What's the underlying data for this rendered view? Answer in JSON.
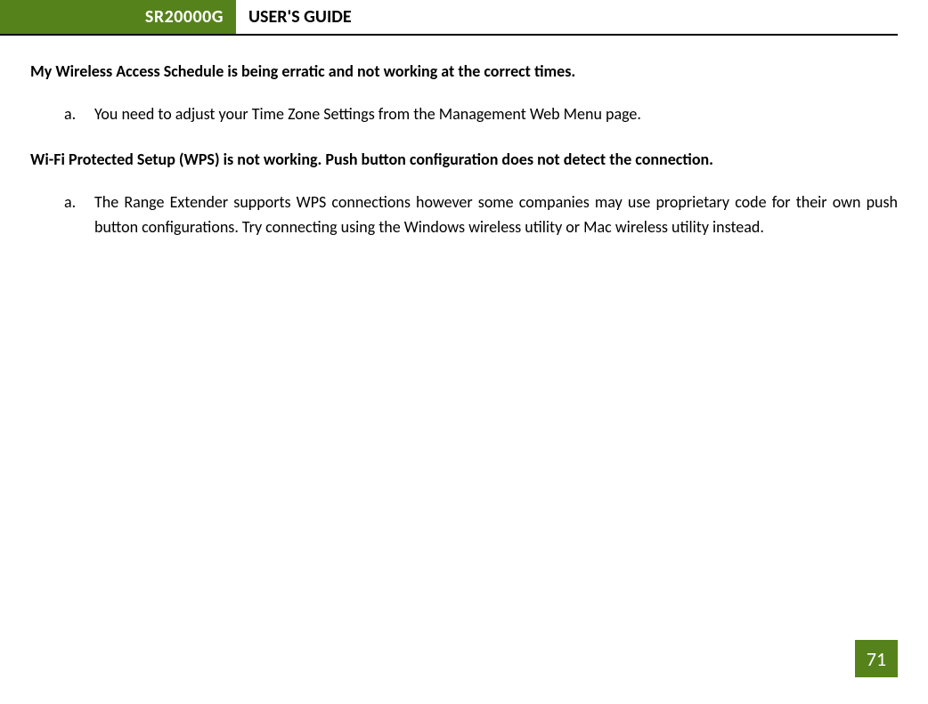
{
  "header": {
    "model": "SR20000G",
    "title": "USER'S GUIDE"
  },
  "sections": [
    {
      "heading": "My Wireless Access Schedule is being erratic and not working at the correct times.",
      "items": [
        {
          "marker": "a.",
          "text": "You need to adjust your Time Zone Settings from the Management Web Menu page."
        }
      ]
    },
    {
      "heading": "Wi-Fi Protected Setup (WPS) is not working. Push button configuration does not detect the connection.",
      "items": [
        {
          "marker": "a.",
          "text": "The Range Extender supports WPS connections however some companies may use proprietary code for their own push button configurations. Try connecting using the Windows wireless utility or Mac wireless utility instead."
        }
      ]
    }
  ],
  "page_number": "71"
}
